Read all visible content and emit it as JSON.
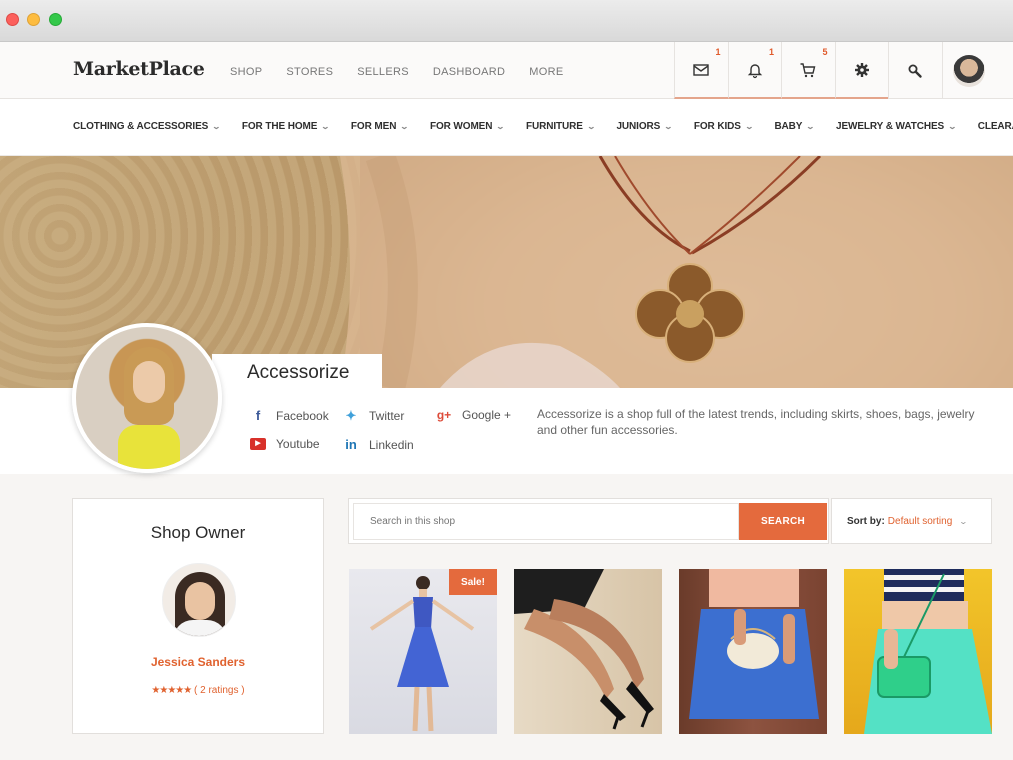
{
  "header": {
    "logo": "MarketPlace",
    "nav": [
      "SHOP",
      "STORES",
      "SELLERS",
      "DASHBOARD",
      "MORE"
    ],
    "icons": [
      {
        "name": "mail-icon",
        "badge": "1"
      },
      {
        "name": "bell-icon",
        "badge": "1"
      },
      {
        "name": "cart-icon",
        "badge": "5"
      },
      {
        "name": "gear-icon",
        "badge": ""
      },
      {
        "name": "search-icon",
        "badge": ""
      }
    ]
  },
  "categories": [
    "CLOTHING & ACCESSORIES",
    "FOR THE HOME",
    "FOR MEN",
    "FOR WOMEN",
    "FURNITURE",
    "JUNIORS",
    "FOR KIDS",
    "BABY",
    "JEWELRY & WATCHES",
    "CLEARANCE"
  ],
  "shop": {
    "name": "Accessorize",
    "description": "Accessorize is a shop full of the latest trends, including skirts, shoes, bags, jewelry and other fun accessories.",
    "social": [
      {
        "label": "Facebook",
        "icon": "facebook-icon"
      },
      {
        "label": "Twitter",
        "icon": "twitter-icon"
      },
      {
        "label": "Google +",
        "icon": "google-plus-icon"
      },
      {
        "label": "Youtube",
        "icon": "youtube-icon"
      },
      {
        "label": "Linkedin",
        "icon": "linkedin-icon"
      }
    ]
  },
  "owner": {
    "title": "Shop Owner",
    "name": "Jessica Sanders",
    "stars": "★★★★★",
    "ratings": "( 2 ratings )"
  },
  "search": {
    "placeholder": "Search in this shop",
    "button": "SEARCH"
  },
  "sort": {
    "label": "Sort by:",
    "value": "Default sorting"
  },
  "products": [
    {
      "badge": "Sale!"
    },
    {
      "badge": ""
    },
    {
      "badge": ""
    },
    {
      "badge": ""
    }
  ],
  "colors": {
    "accent": "#e46a3d",
    "badge": "#e05a2b"
  }
}
